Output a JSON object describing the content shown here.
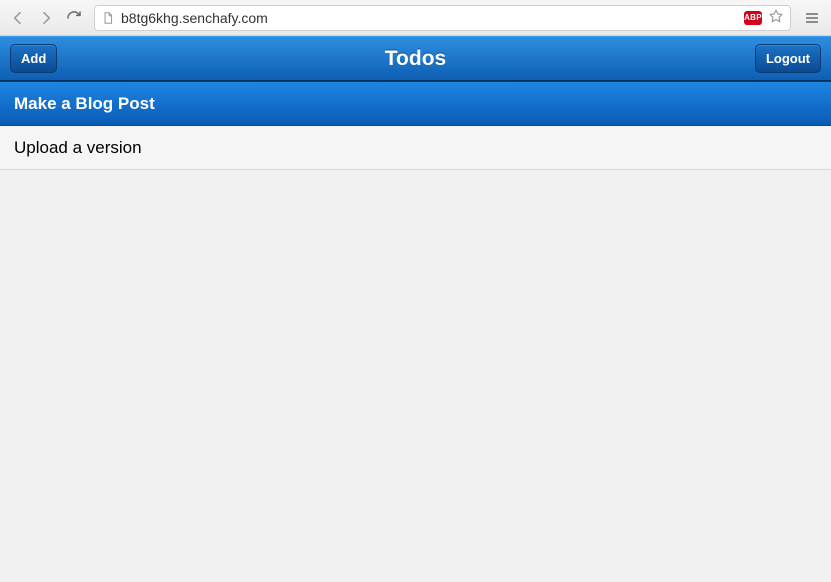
{
  "browser": {
    "url": "b8tg6khg.senchafy.com",
    "abp_label": "ABP"
  },
  "toolbar": {
    "add_label": "Add",
    "title": "Todos",
    "logout_label": "Logout"
  },
  "list": {
    "items": [
      {
        "label": "Make a Blog Post",
        "selected": true
      },
      {
        "label": "Upload a version",
        "selected": false
      }
    ]
  }
}
